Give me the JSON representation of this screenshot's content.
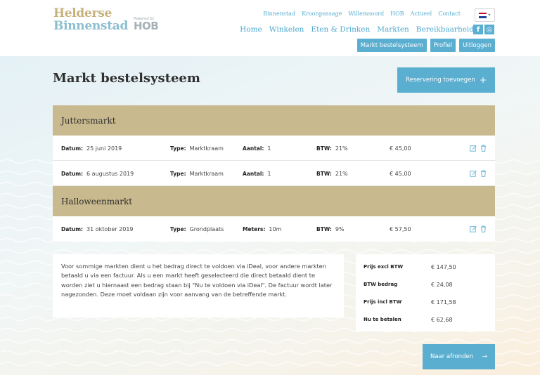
{
  "brand": {
    "line1": "Helderse",
    "line2": "Binnenstad",
    "powered_small": "Powered by",
    "powered_big": "HOB"
  },
  "topnav": [
    "Binnenstad",
    "Kroonpassage",
    "Willemsoord",
    "HOB",
    "Actueel",
    "Contact"
  ],
  "mainnav": [
    "Home",
    "Winkelen",
    "Eten & Drinken",
    "Markten",
    "Bereikbaarheid"
  ],
  "social": [
    "f",
    "◎"
  ],
  "language": {
    "flag": "nl-flag",
    "caret": "▾"
  },
  "user_buttons": [
    "Markt bestelsysteem",
    "Profiel",
    "Uitloggen"
  ],
  "page": {
    "title": "Markt bestelsysteem",
    "add_button": "Reservering toevoegen",
    "add_button_icon": "+"
  },
  "markets": [
    {
      "name": "Juttersmarkt",
      "rows": [
        {
          "date_label": "Datum:",
          "date": "25 juni 2019",
          "type_label": "Type:",
          "type": "Marktkraam",
          "qty_label": "Aantal:",
          "qty": "1",
          "btw_label": "BTW:",
          "btw": "21%",
          "price": "€ 45,00"
        },
        {
          "date_label": "Datum:",
          "date": "6 augustus 2019",
          "type_label": "Type:",
          "type": "Marktkraam",
          "qty_label": "Aantal:",
          "qty": "1",
          "btw_label": "BTW:",
          "btw": "21%",
          "price": "€ 45,00"
        }
      ]
    },
    {
      "name": "Halloweenmarkt",
      "rows": [
        {
          "date_label": "Datum:",
          "date": "31 oktober 2019",
          "type_label": "Type:",
          "type": "Grondplaats",
          "qty_label": "Meters:",
          "qty": "10m",
          "btw_label": "BTW:",
          "btw": "9%",
          "price": "€ 57,50"
        }
      ]
    }
  ],
  "info_text": "Voor sommige markten dient u het bedrag direct te voldoen via iDeal, voor andere markten betaald u via een factuur. Als u een markt heeft geselecteerd die direct betaald dient te worden ziet u hiernaast een bedrag staan bij \"Nu te voldoen via iDeal\". De factuur wordt later nagezonden. Deze moet voldaan zijn voor aanvang van de betreffende markt.",
  "totals": [
    {
      "label": "Prijs excl BTW",
      "value": "€ 147,50"
    },
    {
      "label": "BTW bedrag",
      "value": "€ 24,08"
    },
    {
      "label": "Prijs incl BTW",
      "value": "€ 171,58"
    },
    {
      "label": "Nu te betalen",
      "value": "€ 62,68"
    }
  ],
  "finish_button": "Naar afronden",
  "finish_button_icon": "→",
  "colors": {
    "accent": "#5aaed0",
    "market_header": "#c9b98e",
    "logo_gold": "#c8b27c",
    "logo_blue": "#8bbfd0"
  }
}
